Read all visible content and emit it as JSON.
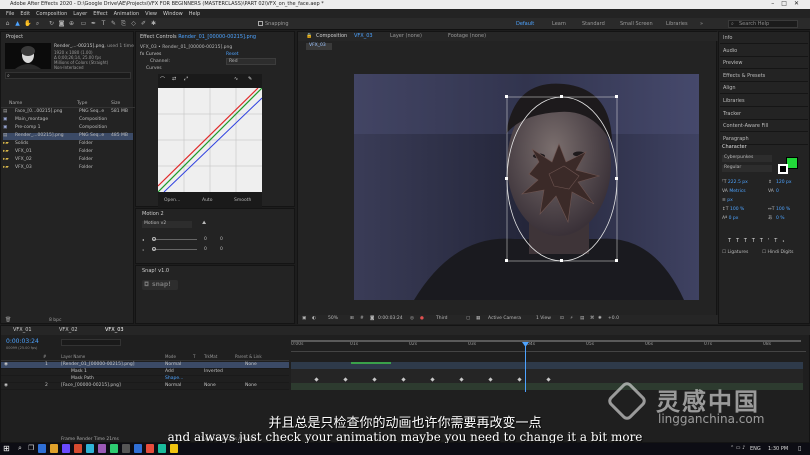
{
  "window": {
    "title": "Adobe After Effects 2020 - D:\\Google Drive\\AE\\Projects\\VFX FOR BEGINNERS (MASTERCLASS)\\PART 02\\VFX_on_the_face.aep *"
  },
  "menu": [
    "File",
    "Edit",
    "Composition",
    "Layer",
    "Effect",
    "Animation",
    "View",
    "Window",
    "Help"
  ],
  "toolbar": {
    "snapping": "Snapping",
    "workspaces": [
      "Default",
      "Learn",
      "Standard",
      "Small Screen",
      "Libraries"
    ],
    "search_placeholder": "Search Help"
  },
  "project": {
    "tab": "Project",
    "selected_name": "Render_...-00215].png",
    "used": ", used 1 time",
    "info": [
      "1920 x 1080 (1.00)",
      "Δ 0;00;26;14, 25.00 fps",
      "Millions of Colors (Straight)",
      "Non-Interlaced"
    ],
    "columns": [
      "Name",
      "Type",
      "Size"
    ],
    "items": [
      {
        "name": "Face_[0...00215].png",
        "type": "PNG Seq..e",
        "size": "581 MB"
      },
      {
        "name": "Main_montage",
        "type": "Composition",
        "size": ""
      },
      {
        "name": "Pre-comp 1",
        "type": "Composition",
        "size": ""
      },
      {
        "name": "Render_...00215].png",
        "type": "PNG Seq..e",
        "size": "485 MB"
      },
      {
        "name": "Solids",
        "type": "Folder",
        "size": ""
      },
      {
        "name": "VFX_01",
        "type": "Folder",
        "size": ""
      },
      {
        "name": "VFX_02",
        "type": "Folder",
        "size": ""
      },
      {
        "name": "VFX_03",
        "type": "Folder",
        "size": ""
      }
    ],
    "footer": "8 bpc"
  },
  "effect_controls": {
    "tab": "Effect Controls",
    "tab_file": "Render_01_[00000-00215].png",
    "path": "VFX_03 • Render_01_[00000-00215].png",
    "effect": "Curves",
    "reset": "Reset",
    "channel_label": "Channel:",
    "channel_value": "Red",
    "curves_label": "Curves",
    "buttons": [
      "Open...",
      "Auto",
      "Smooth"
    ]
  },
  "motion2": {
    "tab": "Motion 2",
    "preset": "Motion v2",
    "values": [
      "0",
      "0",
      "0",
      "0"
    ]
  },
  "snapit": {
    "tab": "Snap! v1.0",
    "logo": "snap!"
  },
  "composition": {
    "tab": "Composition",
    "comp_name": "VFX_03",
    "other_tabs": [
      "Layer (none)",
      "Footage (none)"
    ],
    "breadcrumb": "VFX_03",
    "zoom": "50%",
    "timecode": "0:00:03:24",
    "resolution": "Third",
    "camera": "Active Camera",
    "views": "1 View",
    "exposure": "+0.0"
  },
  "right_panel": {
    "items": [
      "Info",
      "Audio",
      "Preview",
      "Effects & Presets",
      "Align",
      "Libraries",
      "Tracker",
      "Content-Aware Fill",
      "Paragraph"
    ],
    "character": {
      "title": "Character",
      "font": "Cyberpunkes",
      "style": "Regular",
      "size": "222.5 px",
      "leading": "120 px",
      "kerning": "Metrics",
      "tracking": "0",
      "stroke": "px",
      "vscale": "100 %",
      "hscale": "100 %",
      "baseline": "0 px",
      "tsume": "0 %",
      "ligatures": "Ligatures",
      "hindi": "Hindi Digits",
      "swatch_color": "#22d83a"
    }
  },
  "timeline": {
    "comp_tabs": [
      "VFX_01",
      "VFX_02",
      "VFX_03"
    ],
    "timecode": "0:00:03:24",
    "frame_info": "00099 (25.00 fps)",
    "columns": [
      "#",
      "Layer Name",
      "Mode",
      "T",
      "TrkMat",
      "Parent & Link"
    ],
    "layers": [
      {
        "num": "1",
        "name": "[Render_01_[00000-00215].png]",
        "mode": "Normal",
        "trkmat": "",
        "parent": "None",
        "selected": true
      },
      {
        "num": "",
        "name": "Mask 1",
        "mode": "Add",
        "trkmat": "Inverted",
        "parent": "",
        "selected": false
      },
      {
        "num": "",
        "name": "Mask Path",
        "mode": "Shape...",
        "trkmat": "",
        "parent": "",
        "selected": false
      },
      {
        "num": "2",
        "name": "[Face_[00000-00215].png]",
        "mode": "Normal",
        "trkmat": "None",
        "parent": "None",
        "selected": false
      }
    ],
    "ruler": [
      "0:00s",
      "01s",
      "02s",
      "03s",
      "04s",
      "05s",
      "06s",
      "07s",
      "08s"
    ],
    "frame_render_time": "Frame Render Time 21ms",
    "toggle": "Toggle Switches / Modes"
  },
  "subtitles": {
    "chinese": "并且总是只检查你的动画也许你需要再改变一点",
    "english": "and always just check your animation maybe you need to change it a bit more"
  },
  "watermark": {
    "cn": "灵感中国",
    "url": "lingganchina.com"
  },
  "taskbar": {
    "lang": "ENG",
    "time": "1:30 PM",
    "icon_colors": [
      "#2f6fd6",
      "#e0a12b",
      "#6a4aff",
      "#d64a2f",
      "#2fb3d6",
      "#9b59b6",
      "#2ecc71",
      "#555555",
      "#2f6fd6",
      "#e74c3c",
      "#1abc9c",
      "#f1c40f"
    ]
  }
}
